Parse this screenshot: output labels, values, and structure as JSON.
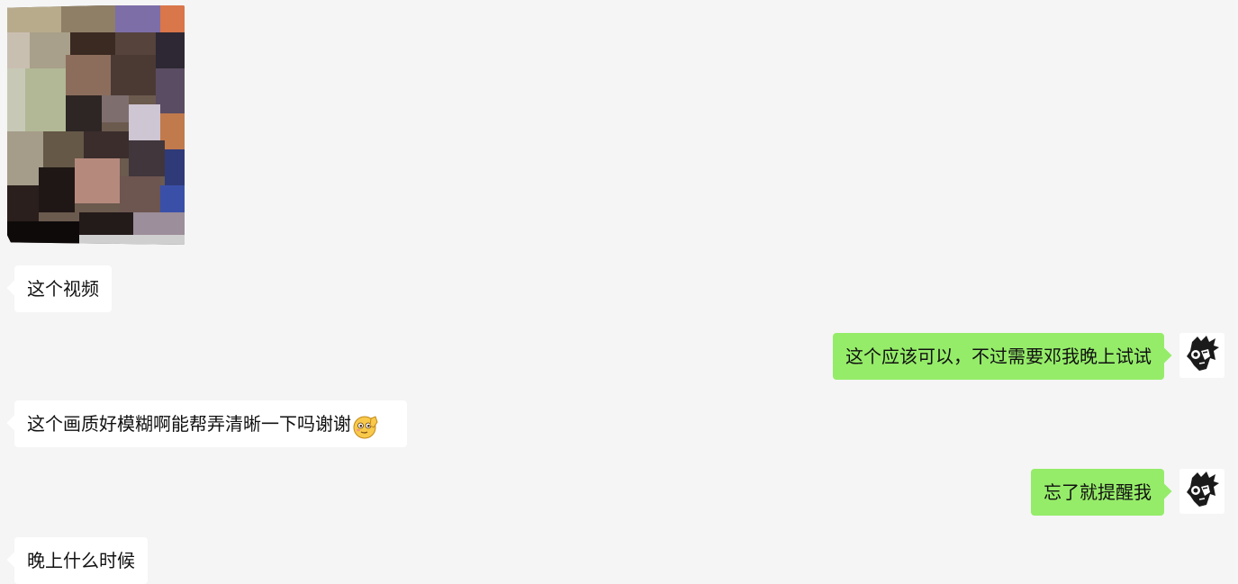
{
  "chat": {
    "messages": [
      {
        "side": "in",
        "type": "video",
        "icon": "video-thumbnail"
      },
      {
        "side": "in",
        "type": "text",
        "text": "这个视频"
      },
      {
        "side": "out",
        "type": "text",
        "text": "这个应该可以，不过需要邓我晚上试试"
      },
      {
        "side": "in",
        "type": "text",
        "text": "这个画质好模糊啊能帮弄清晰一下吗谢谢",
        "emoji": "pray-smile-emoji"
      },
      {
        "side": "out",
        "type": "text",
        "text": "忘了就提醒我"
      },
      {
        "side": "in",
        "type": "text",
        "text": "晚上什么时候"
      }
    ]
  },
  "colors": {
    "background": "#f5f5f5",
    "incoming_bubble": "#ffffff",
    "outgoing_bubble": "#95ec69",
    "text": "#111111"
  }
}
